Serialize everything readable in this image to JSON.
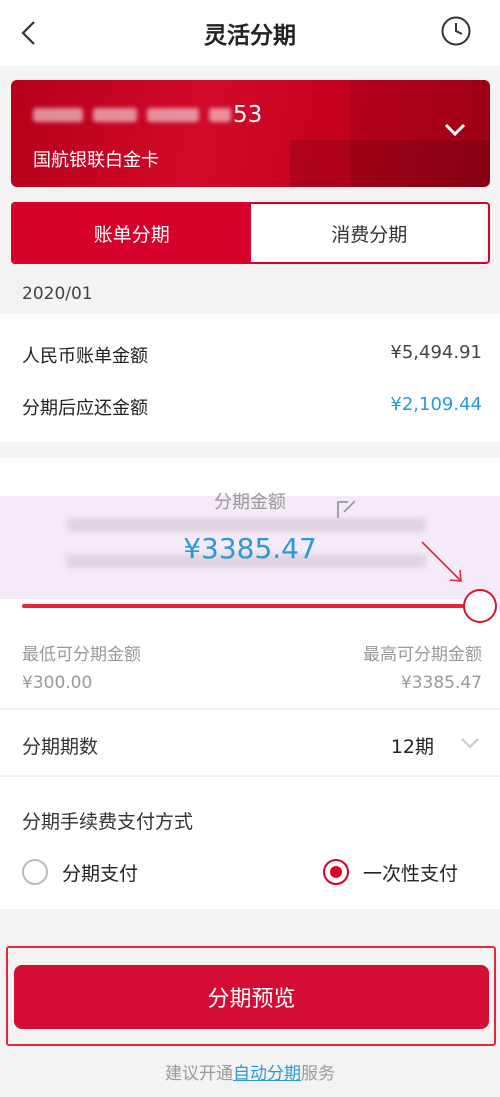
{
  "header": {
    "title": "灵活分期"
  },
  "card": {
    "number_suffix": "53",
    "name": "国航银联白金卡"
  },
  "tabs": [
    {
      "label": "账单分期",
      "active": true
    },
    {
      "label": "消费分期",
      "active": false
    }
  ],
  "bill": {
    "date": "2020/01",
    "rows": [
      {
        "label": "人民币账单金额",
        "value": "¥5,494.91"
      },
      {
        "label": "分期后应还金额",
        "value": "¥2,109.44"
      }
    ]
  },
  "slider": {
    "label": "分期金额",
    "value": "¥3385.47",
    "fill_fraction": 1.0,
    "min_label": "最低可分期金额",
    "min_value": "¥300.00",
    "max_label": "最高可分期金额",
    "max_value": "¥3385.47"
  },
  "period": {
    "label": "分期期数",
    "value": "12期"
  },
  "payment": {
    "label": "分期手续费支付方式",
    "options": [
      {
        "label": "分期支付",
        "checked": false
      },
      {
        "label": "一次性支付",
        "checked": true
      }
    ]
  },
  "preview_button": "分期预览",
  "footer": {
    "prefix": "建议开通",
    "link": "自动分期",
    "suffix": "服务"
  },
  "colors": {
    "brand_red": "#d6002b",
    "link_blue": "#2a9ad6"
  }
}
